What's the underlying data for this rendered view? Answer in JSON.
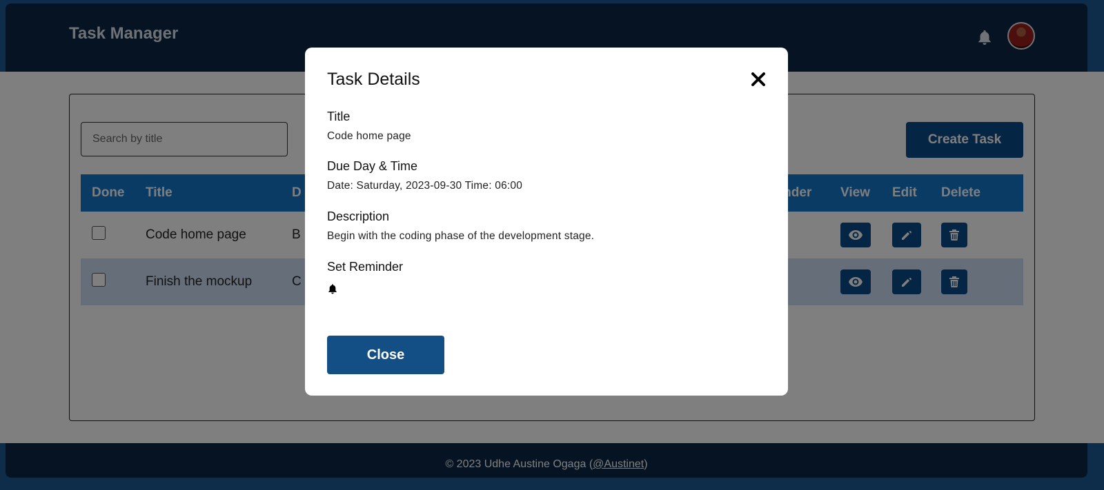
{
  "header": {
    "title": "Task Manager",
    "notifications_icon": "bell-icon",
    "avatar_icon": "user-avatar"
  },
  "toolbar": {
    "search_placeholder": "Search by title",
    "create_label": "Create Task"
  },
  "table": {
    "columns": [
      "Done",
      "Title",
      "D",
      "minder",
      "View",
      "Edit",
      "Delete"
    ],
    "rows": [
      {
        "done": false,
        "title": "Code home page",
        "desc_fragment": "B"
      },
      {
        "done": false,
        "title": "Finish the mockup",
        "desc_fragment": "C"
      }
    ],
    "actions": {
      "view_icon": "eye-icon",
      "edit_icon": "pencil-icon",
      "delete_icon": "trash-icon",
      "reminder_icon": "search-icon"
    }
  },
  "footer": {
    "prefix": "© 2023 Udhe Austine Ogaga (",
    "link": "@Austinet",
    "suffix": ")"
  },
  "modal": {
    "title": "Task Details",
    "close_icon": "close-icon",
    "title_label": "Title",
    "title_value": "Code home page",
    "due_label": "Due Day & Time",
    "due_value": "Date: Saturday, 2023-09-30 Time: 06:00",
    "description_label": "Description",
    "description_value": "Begin with the coding phase of the development stage.",
    "reminder_label": "Set Reminder",
    "reminder_icon": "bell-icon",
    "close_label": "Close"
  },
  "colors": {
    "frame": "#1a5a96",
    "header_bg": "#0a2744",
    "table_header": "#1577c9",
    "button": "#0a4a8a",
    "row_alt": "#ccdcf2",
    "modal_button": "#134f85"
  }
}
